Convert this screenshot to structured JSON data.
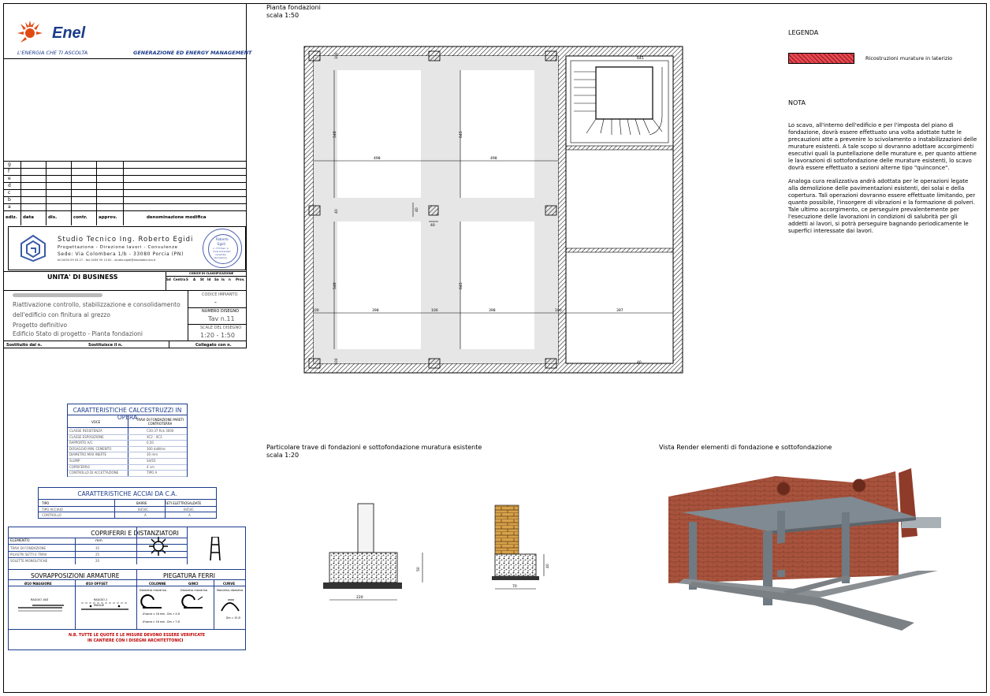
{
  "logo": {
    "brand": "Enel",
    "slogan": "L'ENERGIA CHE TI ASCOLTA",
    "division": "GENERAZIONE ED ENERGY MANAGEMENT"
  },
  "revision_table": {
    "rows": [
      "g",
      "f",
      "e",
      "d",
      "c",
      "b",
      "a"
    ],
    "headers": [
      "ediz.",
      "data",
      "dis.",
      "contr.",
      "approv.",
      "denominazione modifica"
    ]
  },
  "studio": {
    "name": "Studio Tecnico Ing. Roberto Egidi",
    "line1": "Progettazione - Direzione lavori - Consulenze",
    "line2": "Sede: Via Colombera 1/b - 33080 Porcia (PN)",
    "line3": "tel.0434 59 03 27 - fax 0434 59 13 81 - studio.egidi@studiotecnico.it",
    "stamp_name": "Roberto",
    "stamp_surname": "Egidi",
    "stamp_number": "n. 770 Sez. A",
    "stamp_text1": "Civile ambientale",
    "stamp_text2": "industriale",
    "stamp_text3": "informazione"
  },
  "unita": {
    "label": "UNITA' DI BUSINESS",
    "codice_label": "CODICE DI CLASSIFICAZIONE",
    "codice_cols": [
      "Sd",
      "Centra",
      "S",
      "A",
      "St",
      "Id",
      "Sa",
      "Is",
      "n",
      "Prov."
    ]
  },
  "description": {
    "lines": [
      "Riattivazione controllo, stabilizzazione e consolidamento",
      "dell'edificio con finitura al grezzo",
      "Progetto definitivo",
      "Edificio Stato di progetto - Pianta fondazioni"
    ],
    "codice_impianto_label": "CODICE IMPIANTO",
    "codice_impianto_value": "-",
    "numero_disegno_label": "NUMERO DISEGNO",
    "numero_disegno_value": "Tav n.11",
    "scale_label": "SCALE DEL DISEGNO",
    "scale_value": "1:20 - 1:50"
  },
  "footer": {
    "sostituito": "Sostituito dal n.",
    "sostituisce": "Sostituisce il n.",
    "collegato": "Collegato con n."
  },
  "calcestruzzi": {
    "title": "CARATTERISTICHE CALCESTRUZZI IN OPERA",
    "col1": "VOCE",
    "col2": "TRAVI DI FONDAZIONE PARETI CONTROTERRA",
    "rows": [
      [
        "CLASSE RESISTENZA",
        "C30-37 Rck 3000"
      ],
      [
        "CLASSE ESPOSIZIONE",
        "XC2 - XC3"
      ],
      [
        "RAPPORTO A/C",
        "0,50"
      ],
      [
        "DOSAGGIO MIN. CEMENTO",
        "300 daN/mc"
      ],
      [
        "DIAMETRO MAX INERTE",
        "30 mm"
      ],
      [
        "SLUMP",
        "S4/S5"
      ],
      [
        "COPRIFERRO",
        "4 cm"
      ],
      [
        "CONTROLLO DI ACCETTAZIONE",
        "TIPO A"
      ]
    ]
  },
  "acciai": {
    "title": "CARATTERISTICHE ACCIAI DA C.A.",
    "headers": [
      "TIPO",
      "BARRE",
      "RETI ELETTROSALDATE"
    ],
    "rows": [
      [
        "TIPO ACCIAIO",
        "B450C",
        "B450C"
      ],
      [
        "CONTROLLO",
        "A",
        "A"
      ]
    ]
  },
  "copriferri": {
    "title": "COPRIFERRI E DISTANZIATORI",
    "headers": [
      "ELEMENTO",
      "mm"
    ],
    "rows": [
      [
        "TRAVI DI FONDAZIONE",
        "35"
      ],
      [
        "PILASTRI SETTI E TRAVI",
        "25"
      ],
      [
        "SOLETTE MONOLITICHE",
        "20"
      ]
    ]
  },
  "sovrapposizioni": {
    "title": "SOVRAPPOSIZIONI ARMATURE",
    "col1": "Ø10 MAGGIORE",
    "col2": "Ø10 OFFSET",
    "lbl1": "RAGGIO 10Ø",
    "lbl2": "RAGGIO 2",
    "lbl3": "MAGLIE"
  },
  "piegatura": {
    "title": "PIEGATURA FERRI",
    "cols": [
      "COLONNE",
      "GINCI",
      "CURVE"
    ],
    "sub1": "Diametro mandrino",
    "sub2": "Diametro mandrino",
    "sub3": "Mandrino diametro",
    "f1": "Ø barra < 16 mm - Dm = 4 Ø",
    "f2": "Ø barra > 16 mm - Dm = 7 Ø",
    "f3": "Dm = 15 Ø"
  },
  "nb": {
    "line1": "N.B. TUTTE LE QUOTE E LE MISURE DEVONO ESSERE VERIFICATE",
    "line2": "IN CANTIERE CON I DISEGNI ARCHITETTONICI"
  },
  "plan": {
    "title": "Pianta fondazioni",
    "scale": "scala 1:50",
    "dims": {
      "top_left": "498",
      "top_right": "498",
      "mid_left": "398",
      "mid_center": "100",
      "mid_right": "398",
      "right_mid": "397",
      "left_top": "548",
      "left_mid": "645",
      "left_bot": "548",
      "right_top": "645",
      "right_bot": "645",
      "center_v": "40",
      "center_h": "40",
      "corner_a": "100",
      "corner_b": "40",
      "corner_c": "100",
      "corner_d": "40",
      "edge_l": "100",
      "edge_r": "100"
    }
  },
  "legend": {
    "title": "LEGENDA",
    "item": "Ricostruzioni murature in laterizio",
    "swatch_color": "#e8474f"
  },
  "nota": {
    "title": "NOTA",
    "p1": "Lo scavo, all'interno dell'edificio e per l'imposta del piano di fondazione, dovrà essere effettuato una volta adottate tutte le precauzioni atte a prevenire lo scivolamento o instabilizzazioni delle murature esistenti. A tale scopo si dovranno adottare accorgimenti esecutivi quali la puntellazione delle murature e, per quanto attiene le lavorazioni di sottofondazione delle murature esistenti, lo scavo dovrà essere effettuato a sezioni alterne tipo \"quinconce\".",
    "p2": "Analoga cura realizzativa andrà adottata per le operazioni legate alla demolizione delle pavimentazioni esistenti, dei solai e della copertura. Tali operazioni dovranno essere effettuate limitando, per quanto possibile, l'insorgere di vibrazioni e la formazione di polveri. Tale ultimo accorgimento, ce perseguire prevalentemente per l'esecuzione delle lavorazioni in condizioni di salubrità per gli addetti ai lavori, si potrà perseguire bagnando periodicamente le superfici interessate dai lavori."
  },
  "particolare": {
    "title": "Particolare trave di fondazioni e sottofondazione muratura esistente",
    "scale": "scala 1:20",
    "dim_h1": "50",
    "dim_w1": "220",
    "dim_h2": "40",
    "dim_w2": "70"
  },
  "render": {
    "title": "Vista Render elementi di fondazione e sottofondazione"
  }
}
